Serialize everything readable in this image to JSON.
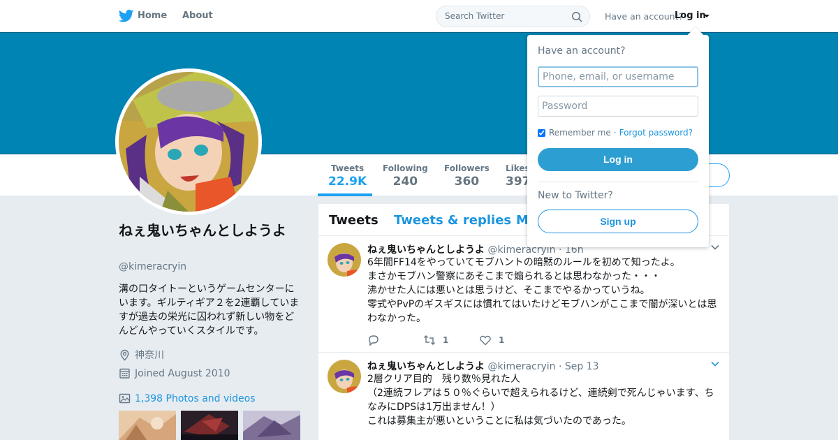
{
  "nav": {
    "home_label": "Home",
    "about_label": "About",
    "search_placeholder": "Search Twitter",
    "have_account": "Have an account?",
    "login_label": "Log in"
  },
  "colors": {
    "banner": "#0084b4",
    "accent": "#1da1f2",
    "link": "#1b95e0"
  },
  "stats": [
    {
      "label": "Tweets",
      "value": "22.9K"
    },
    {
      "label": "Following",
      "value": "240"
    },
    {
      "label": "Followers",
      "value": "360"
    },
    {
      "label": "Likes",
      "value": "397"
    }
  ],
  "profile": {
    "name": "ねぇ鬼いちゃんとしようよ",
    "handle": "@kimeracryin",
    "bio": "溝の口タイトーというゲームセンターにいます。ギルティギア２を2連覇していますが過去の栄光に囚われず新しい物をどんどんやっていくスタイルです。",
    "location": "神奈川",
    "joined": "Joined August 2010",
    "photos": "1,398 Photos and videos"
  },
  "tabs": [
    "Tweets",
    "Tweets & replies",
    "M"
  ],
  "tweets": [
    {
      "name": "ねぇ鬼いちゃんとしようよ",
      "handle": "@kimeracryin",
      "time": "· 16h",
      "lines": [
        "6年間FF14をやっていてモブハントの暗黙のルールを初めて知ったよ。",
        "まさかモブハン警察にあそこまで煽られるとは思わなかった・・・",
        "沸かせた人には悪いとは思うけど、そこまでやるかっていうね。",
        "零式やPvPのギスギスには慣れてはいたけどモブハンがここまで闇が深いとは思わなかった。"
      ],
      "retweets": "1",
      "likes": "1"
    },
    {
      "name": "ねぇ鬼いちゃんとしようよ",
      "handle": "@kimeracryin",
      "time": "· Sep 13",
      "lines": [
        "2層クリア目的　残り数％見れた人",
        "（2連続フレアは５０％ぐらいで超えられるけど、連続剣で死んじゃいます、ちなみにDPSは1万出ません！）",
        "これは募集主が悪いということに私は気づいたのであった。"
      ]
    }
  ],
  "login_dropdown": {
    "title": "Have an account?",
    "user_placeholder": "Phone, email, or username",
    "password_placeholder": "Password",
    "remember": "Remember me",
    "separator": "·",
    "forgot": "Forgot password?",
    "login_button": "Log in",
    "new_to_twitter": "New to Twitter?",
    "signup_button": "Sign up"
  }
}
